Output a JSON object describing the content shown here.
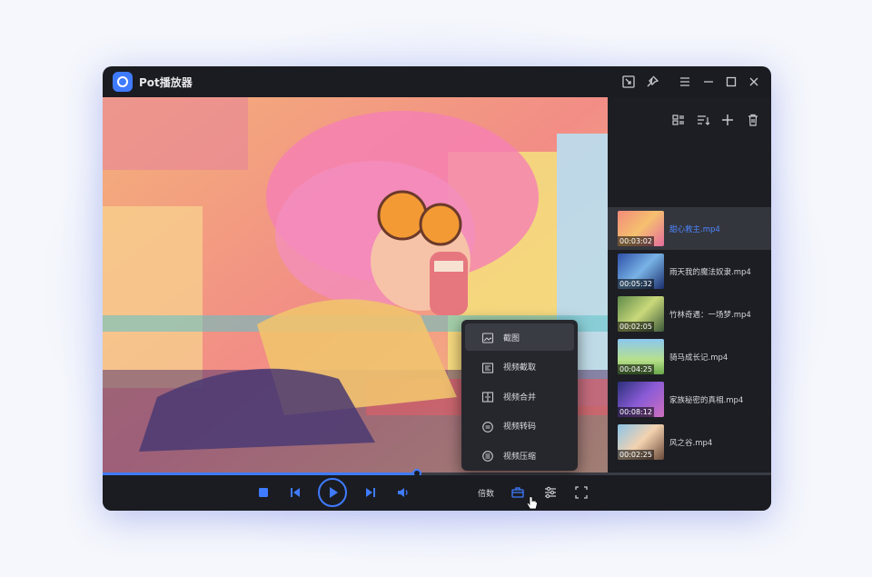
{
  "app": {
    "title": "Pot播放器"
  },
  "playlist": [
    {
      "name": "甜心救主.mp4",
      "duration": "00:03:02",
      "active": true
    },
    {
      "name": "雨天我的魔法奴隶.mp4",
      "duration": "00:05:32",
      "active": false
    },
    {
      "name": "竹林奇遇：一场梦.mp4",
      "duration": "00:02:05",
      "active": false
    },
    {
      "name": "骑马成长记.mp4",
      "duration": "00:04:25",
      "active": false
    },
    {
      "name": "家族秘密的真相.mp4",
      "duration": "00:08:12",
      "active": false
    },
    {
      "name": "风之谷.mp4",
      "duration": "00:02:25",
      "active": false
    }
  ],
  "context_menu": [
    {
      "label": "截图",
      "icon": "image-icon"
    },
    {
      "label": "视频截取",
      "icon": "clip-icon"
    },
    {
      "label": "视频合并",
      "icon": "merge-icon"
    },
    {
      "label": "视频转码",
      "icon": "convert-icon"
    },
    {
      "label": "视频压缩",
      "icon": "compress-icon"
    }
  ],
  "controls": {
    "speed_label": "倍数"
  },
  "progress": {
    "fraction": 0.47
  },
  "colors": {
    "accent": "#3f7bff",
    "window_bg": "#1b1c21",
    "active_row": "#34363e"
  }
}
